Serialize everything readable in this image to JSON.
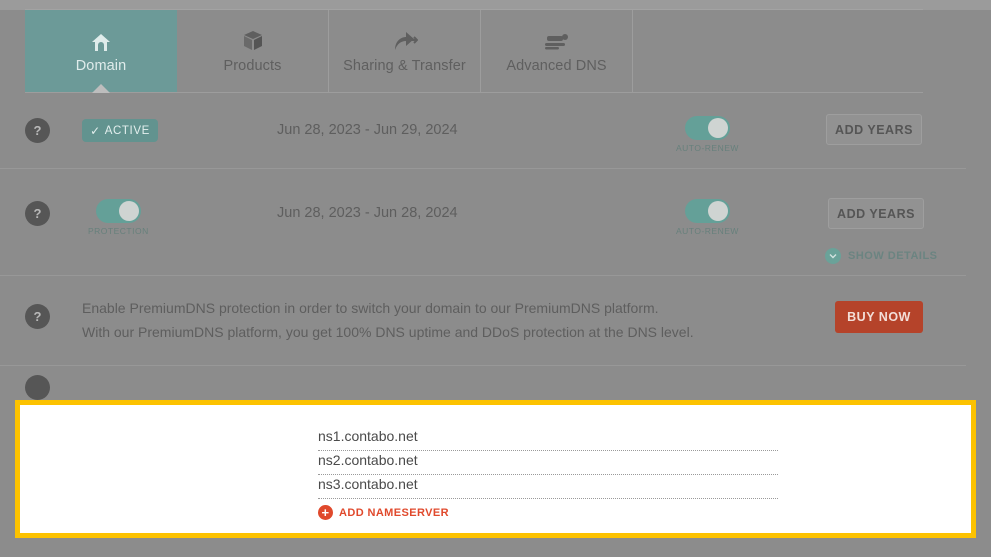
{
  "tabs": [
    {
      "label": "Domain",
      "icon": "home-icon",
      "active": true
    },
    {
      "label": "Products",
      "icon": "box-icon",
      "active": false
    },
    {
      "label": "Sharing & Transfer",
      "icon": "share-arrow-icon",
      "active": false
    },
    {
      "label": "Advanced DNS",
      "icon": "server-stack-icon",
      "active": false
    }
  ],
  "rows": {
    "registration": {
      "help": "?",
      "status_badge": "ACTIVE",
      "status_check": "✓",
      "date_range": "Jun 28, 2023 - Jun 29, 2024",
      "auto_renew_caption": "AUTO-RENEW",
      "auto_renew_on": true,
      "add_years_label": "ADD YEARS"
    },
    "protection": {
      "help": "?",
      "protection_caption": "PROTECTION",
      "protection_on": true,
      "date_range": "Jun 28, 2023 - Jun 28, 2024",
      "auto_renew_caption": "AUTO-RENEW",
      "auto_renew_on": true,
      "add_years_label": "ADD YEARS",
      "show_details_label": "SHOW DETAILS"
    },
    "premiumdns": {
      "help": "?",
      "line1": "Enable PremiumDNS protection in order to switch your domain to our PremiumDNS platform.",
      "line2": "With our PremiumDNS platform, you get 100% DNS uptime and DDoS protection at the DNS level.",
      "buy_label": "BUY NOW"
    }
  },
  "nameservers": {
    "items": [
      {
        "value": "ns1.contabo.net"
      },
      {
        "value": "ns2.contabo.net"
      },
      {
        "value": "ns3.contabo.net"
      }
    ],
    "add_label": "ADD NAMESERVER",
    "add_icon": "plus-circle-icon"
  },
  "colors": {
    "accent_teal": "#64a098",
    "active_tab": "#6c9a98",
    "buy_red": "#b5432a",
    "add_red": "#e0492c",
    "highlight_yellow": "#fcc200",
    "page_dim": "#8c8c8c"
  }
}
